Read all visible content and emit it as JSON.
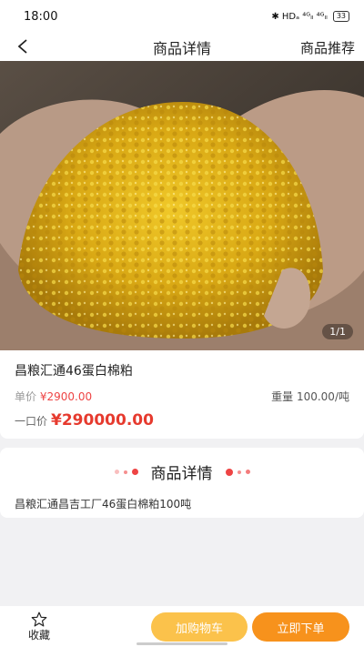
{
  "status_bar": {
    "time": "18:00",
    "indicators": "✱ HDₐ ⁴ᴳₗₗ ⁴ᴳₗₗ",
    "battery": "33"
  },
  "nav": {
    "back_icon": "chevron-left-icon",
    "title": "商品详情",
    "right_link": "商品推荐"
  },
  "gallery": {
    "counter": "1/1"
  },
  "product": {
    "name": "昌粮汇通46蛋白棉粕",
    "unit_price_label": "单价",
    "unit_price": "¥2900.00",
    "weight_label": "重量",
    "weight": "100.00/吨",
    "total_label": "一口价",
    "total_price": "¥290000.00"
  },
  "details": {
    "heading": "商品详情",
    "text": "昌粮汇通昌吉工厂46蛋白棉粕100吨"
  },
  "bottom_bar": {
    "favorite_icon": "star-outline-icon",
    "favorite_label": "收藏",
    "add_to_cart": "加购物车",
    "buy_now": "立即下单"
  },
  "colors": {
    "price_red": "#e63a2e",
    "cart_button": "#fbc24b",
    "buy_button": "#f7921c"
  }
}
